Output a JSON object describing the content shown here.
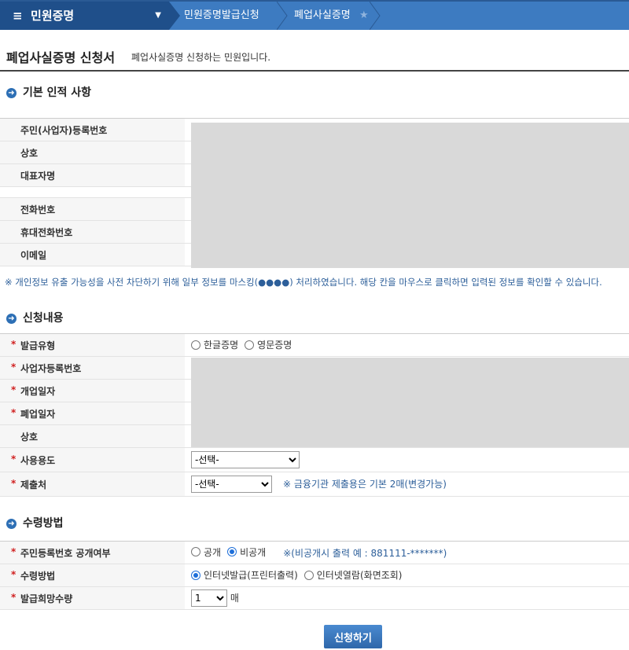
{
  "nav": {
    "menu": "민원증명",
    "crumbs": [
      "민원증명발급신청",
      "폐업사실증명"
    ]
  },
  "page": {
    "title": "폐업사실증명 신청서",
    "subtitle": "폐업사실증명 신청하는 민원입니다."
  },
  "section1": {
    "title": "기본 인적 사항",
    "labels": [
      "주민(사업자)등록번호",
      "상호",
      "대표자명",
      "전화번호",
      "휴대전화번호",
      "이메일"
    ]
  },
  "notice": "※ 개인정보 유출 가능성을 사전 차단하기 위해 일부 정보를 마스킹(●●●●) 처리하였습니다. 해당 칸을 마우스로 클릭하면 입력된 정보를 확인할 수 있습니다.",
  "section2": {
    "title": "신청내용",
    "labels": [
      "발급유형",
      "사업자등록번호",
      "개업일자",
      "폐업일자",
      "상호",
      "사용용도",
      "제출처"
    ],
    "issue_type": [
      "한글증명",
      "영문증명"
    ],
    "purpose": "-선택-",
    "submit_to": "-선택-",
    "submit_hint": "※ 금융기관 제출용은 기본 2매(변경가능)"
  },
  "section3": {
    "title": "수령방법",
    "labels": [
      "주민등록번호 공개여부",
      "수령방법",
      "발급희망수량"
    ],
    "disclose": [
      "공개",
      "비공개"
    ],
    "disclose_hint": "※(비공개시 출력 예 : 881111-*******)",
    "method": [
      "인터넷발급(프린터출력)",
      "인터넷열람(화면조회)"
    ],
    "quantity": "1",
    "unit": "매"
  },
  "submit": "신청하기"
}
